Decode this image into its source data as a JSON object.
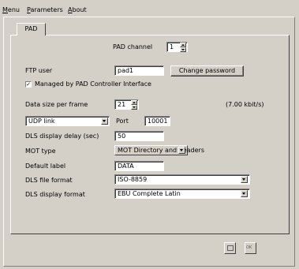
{
  "menu": {
    "items": [
      {
        "label": "enu",
        "mnemonic": "M"
      },
      {
        "label": "arameters",
        "mnemonic": "P"
      },
      {
        "label": "bout",
        "mnemonic": "A"
      }
    ]
  },
  "tabs": [
    {
      "label": "PAD"
    }
  ],
  "pad": {
    "channel_label": "PAD channel",
    "channel_value": "1",
    "ftp_user_label": "FTP user",
    "ftp_user_value": "pad1",
    "change_password_label": "Change password",
    "managed_checkbox_label": "Managed by PAD Controller Interface",
    "managed_checked": true,
    "data_size_label": "Data size per frame",
    "data_size_value": "21",
    "rate_text": "(7.00 kbit/s)",
    "link_type_value": "UDP link",
    "port_label": "Port",
    "port_value": "10001",
    "dls_delay_label": "DLS display delay (sec)",
    "dls_delay_value": "50",
    "mot_type_label": "MOT type",
    "mot_type_value": "MOT Directory and headers",
    "default_label_label": "Default label",
    "default_label_value": "DATA",
    "dls_file_format_label": "DLS file format",
    "dls_file_format_value": "ISO-8859",
    "dls_display_format_label": "DLS display format",
    "dls_display_format_value": "EBU Complete Latin"
  },
  "footer": {
    "ok_label": "OK"
  }
}
